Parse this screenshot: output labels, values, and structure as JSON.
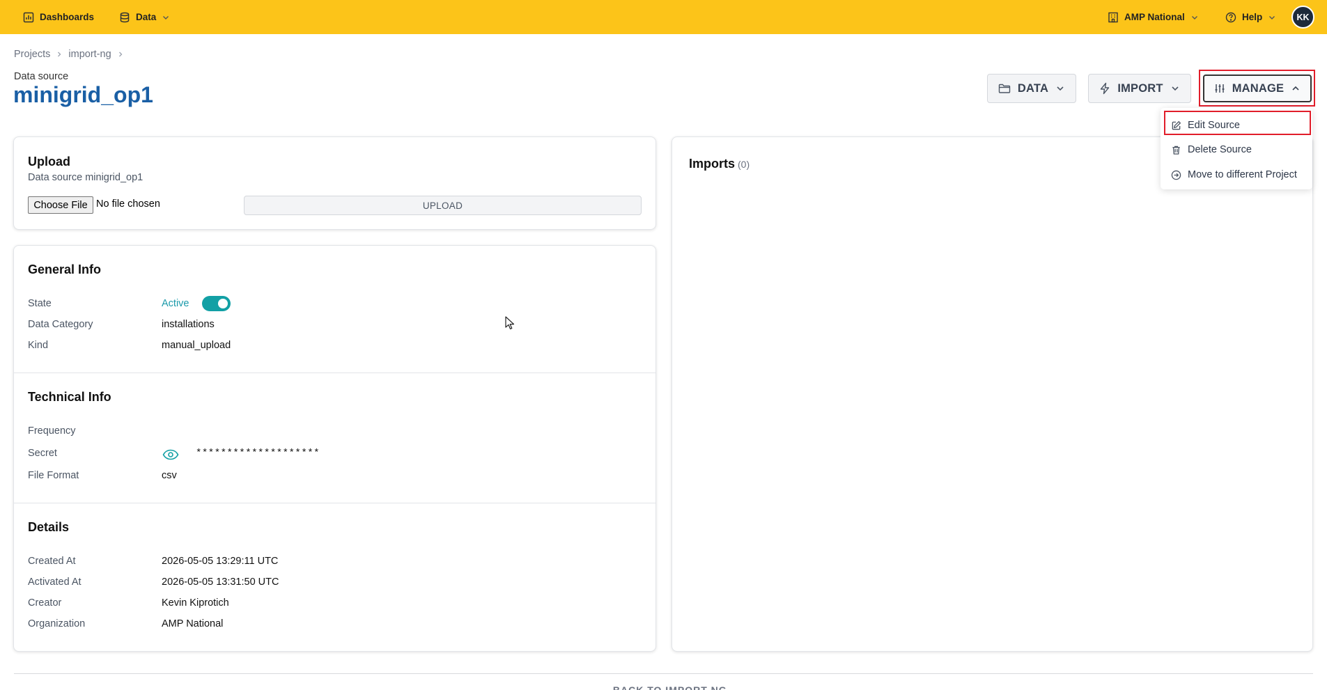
{
  "topbar": {
    "dashboards": "Dashboards",
    "data": "Data",
    "organization": "AMP National",
    "help": "Help",
    "avatar_initials": "KK",
    "background_color": "#fcc419"
  },
  "breadcrumb": [
    "Projects",
    "import-ng"
  ],
  "header": {
    "subtitle": "Data source",
    "title": "minigrid_op1",
    "title_color": "#1a5fa5"
  },
  "actions": {
    "data": "DATA",
    "import": "IMPORT",
    "manage": "MANAGE"
  },
  "manage_menu": {
    "items": [
      {
        "label": "Edit Source",
        "icon": "edit-icon"
      },
      {
        "label": "Delete Source",
        "icon": "trash-icon"
      },
      {
        "label": "Move to different Project",
        "icon": "arrow-circle-right-icon"
      }
    ]
  },
  "upload": {
    "title": "Upload",
    "subtitle": "Data source minigrid_op1",
    "choose_file": "Choose File",
    "no_file": "No file chosen",
    "upload_button": "UPLOAD"
  },
  "general_info": {
    "title": "General Info",
    "state_label": "State",
    "state_value": "Active",
    "state_on": true,
    "category_label": "Data Category",
    "category_value": "installations",
    "kind_label": "Kind",
    "kind_value": "manual_upload"
  },
  "technical_info": {
    "title": "Technical Info",
    "frequency_label": "Frequency",
    "secret_label": "Secret",
    "secret_value": "********************",
    "format_label": "File Format",
    "format_value": "csv"
  },
  "details": {
    "title": "Details",
    "created_label": "Created At",
    "created_value": "2026-05-05 13:29:11 UTC",
    "activated_label": "Activated At",
    "activated_value": "2026-05-05 13:31:50 UTC",
    "creator_label": "Creator",
    "creator_value": "Kevin Kiprotich",
    "org_label": "Organization",
    "org_value": "AMP National"
  },
  "imports": {
    "title": "Imports",
    "count": "(0)"
  },
  "footer": {
    "back_link": "← BACK TO IMPORT-NG"
  },
  "colors": {
    "accent_teal": "#12a0a5",
    "highlight_red": "#e11d2a"
  }
}
